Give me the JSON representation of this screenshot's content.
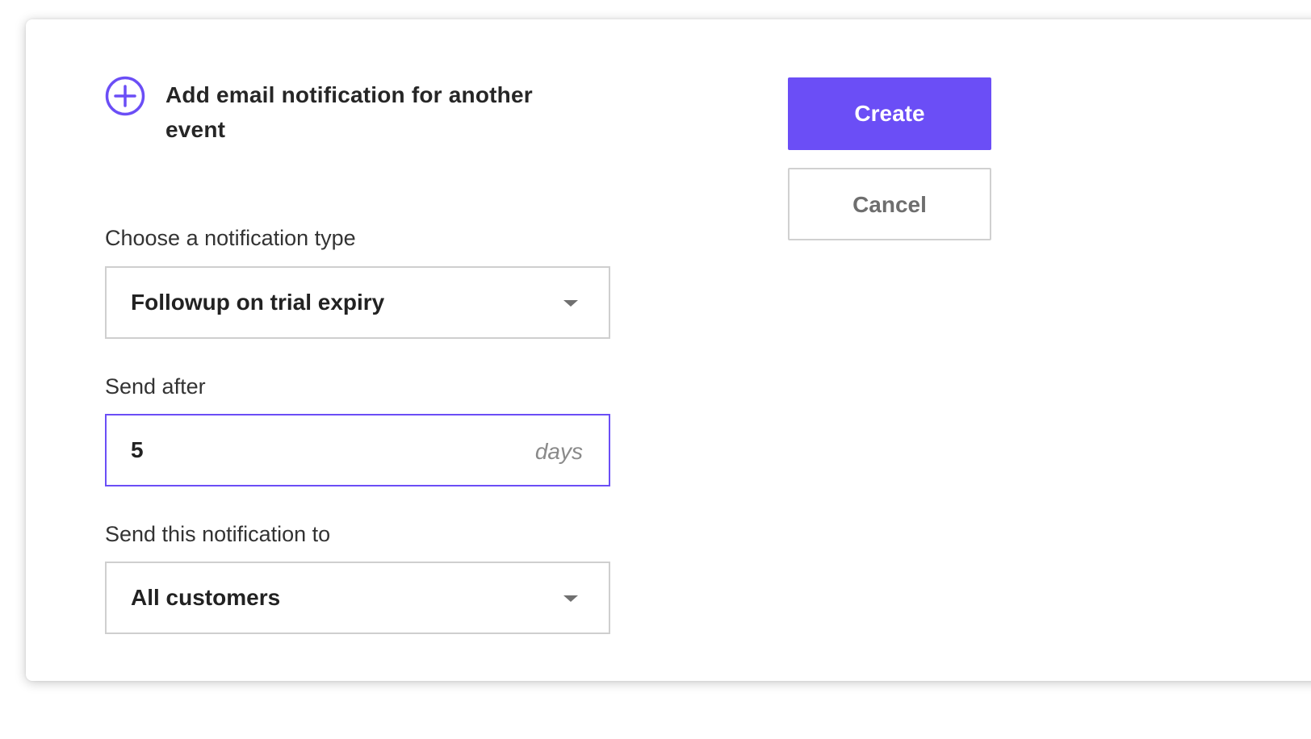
{
  "add_notification": {
    "label": "Add email notification for another event",
    "icon": "plus-circle-icon"
  },
  "notification_type": {
    "label": "Choose a notification type",
    "selected": "Followup on trial expiry"
  },
  "send_after": {
    "label": "Send after",
    "value": "5",
    "unit": "days"
  },
  "recipients": {
    "label": "Send this notification to",
    "selected": "All customers"
  },
  "actions": {
    "create_label": "Create",
    "cancel_label": "Cancel"
  },
  "colors": {
    "accent": "#6b4ef6"
  }
}
